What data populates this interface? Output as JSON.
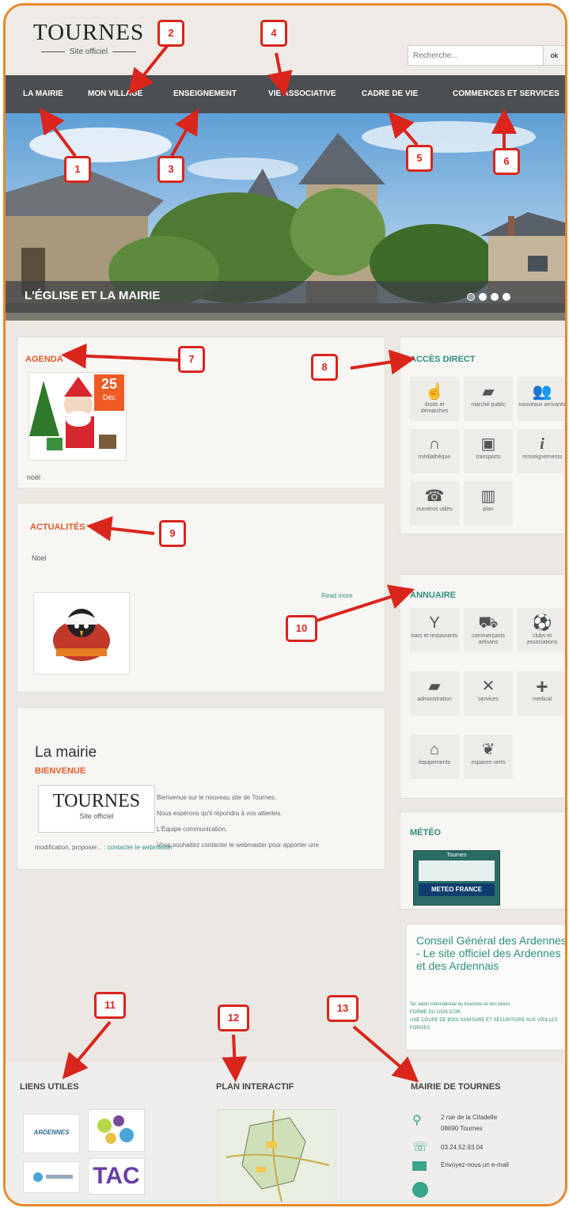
{
  "header": {
    "logo_title": "TOURNES",
    "logo_subtitle": "Site officiel",
    "search_placeholder": "Recherche...",
    "search_button": "ok"
  },
  "nav": {
    "items": [
      {
        "label": "LA MAIRIE"
      },
      {
        "label": "MON VILLAGE"
      },
      {
        "label": "ENSEIGNEMENT"
      },
      {
        "label": "VIE ASSOCIATIVE"
      },
      {
        "label": "CADRE DE VIE"
      },
      {
        "label": "COMMERCES ET SERVICES"
      }
    ]
  },
  "hero": {
    "caption": "L'ÉGLISE ET LA MAIRIE",
    "slide_count": 4,
    "active_slide": 1
  },
  "agenda": {
    "title": "AGENDA",
    "day": "25",
    "month": "Déc",
    "event": "noël"
  },
  "actualites": {
    "title": "ACTUALITÉS",
    "item_title": "Noel",
    "read_more": "Read more"
  },
  "mairie": {
    "title": "La mairie",
    "subtitle": "BIENVENUE",
    "logo_title": "TOURNES",
    "logo_subtitle": "Site officiel",
    "lines": [
      "Bienvenue sur le nouveau site de Tournes.",
      "Nous espérons qu'il répondra à vos attentes.",
      "L'Équipe communication.",
      "Vous souhaitez contacter le webmaster pour apporter une"
    ],
    "last_line_prefix": "modification, proposer... :",
    "contact_link": "contacter le webmaster"
  },
  "acces_direct": {
    "title": "ACCÈS DIRECT",
    "tiles": [
      {
        "icon": "hand-icon",
        "glyph": "☝",
        "label": "droits et démarches"
      },
      {
        "icon": "folder-icon",
        "glyph": "▰",
        "label": "marché public"
      },
      {
        "icon": "people-icon",
        "glyph": "👥",
        "label": "nouveaux arrivants"
      },
      {
        "icon": "headphones-icon",
        "glyph": "∩",
        "label": "médiathèque"
      },
      {
        "icon": "bus-icon",
        "glyph": "▣",
        "label": "transports"
      },
      {
        "icon": "info-icon",
        "glyph": "i",
        "label": "renseignements"
      },
      {
        "icon": "phone-icon",
        "glyph": "☎",
        "label": "numéros utiles"
      },
      {
        "icon": "map-icon",
        "glyph": "▥",
        "label": "plan"
      }
    ]
  },
  "annuaire": {
    "title": "ANNUAIRE",
    "tiles": [
      {
        "icon": "cocktail-icon",
        "glyph": "Y",
        "label": "bars et restaurants"
      },
      {
        "icon": "cart-icon",
        "glyph": "⛟",
        "label": "commerçants artisans"
      },
      {
        "icon": "sport-icon",
        "glyph": "⚽",
        "label": "clubs et associations"
      },
      {
        "icon": "folder-icon",
        "glyph": "▰",
        "label": "administration"
      },
      {
        "icon": "tools-icon",
        "glyph": "✕",
        "label": "services"
      },
      {
        "icon": "plus-icon",
        "glyph": "+",
        "label": "médical"
      },
      {
        "icon": "home-icon",
        "glyph": "⌂",
        "label": "équipements"
      },
      {
        "icon": "leaf-icon",
        "glyph": "❦",
        "label": "espaces verts"
      }
    ]
  },
  "meteo": {
    "title": "MÉTÉO",
    "widget_title": "Tournes",
    "brand": "METEO FRANCE"
  },
  "conseil": {
    "title": "Conseil Général des Ardennes - Le site officiel des Ardennes et des Ardennais",
    "links": [
      "Ter salon international du tourisme et des loisirs",
      "FORME DU LION D'OR",
      "UNE COUPE DE BOIS SANITAIRE ET SÉCURITAIRE AUX VIEILLES FORGES"
    ]
  },
  "footer": {
    "liens_title": "LIENS UTILES",
    "liens_logos": [
      "ARDENNES",
      "TAC"
    ],
    "plan_title": "PLAN INTERACTIF",
    "mairie_title": "MAIRIE DE TOURNES",
    "address_line1": "2 rue de la Citadelle",
    "address_line2": "08090 Tournes",
    "phone": "03.24.52.93.04",
    "email_label": "Envoyez-nous un e-mail"
  },
  "callouts": [
    "1",
    "2",
    "3",
    "4",
    "5",
    "6",
    "7",
    "8",
    "9",
    "10",
    "11",
    "12",
    "13"
  ],
  "colors": {
    "accent_orange": "#e05a2a",
    "accent_teal": "#2f8f7f",
    "callout_red": "#d9251c",
    "nav_bg": "#4b4f52",
    "frame_border": "#e8892a"
  }
}
